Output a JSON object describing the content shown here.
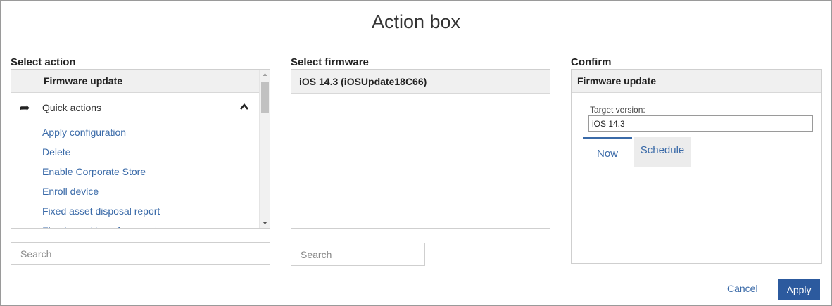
{
  "dialog": {
    "title": "Action box"
  },
  "select_action": {
    "label": "Select action",
    "header": "Firmware update",
    "group": {
      "label": "Quick actions",
      "icon": "share-arrow-icon",
      "toggle_icon": "chevron-up-icon"
    },
    "items": [
      {
        "label": "Apply configuration"
      },
      {
        "label": "Delete"
      },
      {
        "label": "Enable Corporate Store"
      },
      {
        "label": "Enroll device"
      },
      {
        "label": "Fixed asset disposal report"
      },
      {
        "label": "Fixed asset transfer report"
      }
    ],
    "search_placeholder": "Search"
  },
  "select_firmware": {
    "label": "Select firmware",
    "items": [
      {
        "label": "iOS 14.3 (iOSUpdate18C66)"
      }
    ],
    "search_placeholder": "Search"
  },
  "confirm": {
    "label": "Confirm",
    "header": "Firmware update",
    "target_version_label": "Target version:",
    "target_version_value": "iOS 14.3",
    "tabs": [
      {
        "label": "Now",
        "active": true
      },
      {
        "label": "Schedule",
        "active": false
      }
    ]
  },
  "footer": {
    "cancel_label": "Cancel",
    "apply_label": "Apply"
  },
  "colors": {
    "link": "#3a6aa8",
    "primary_button": "#2c5a9e",
    "header_bg": "#f0f0f0",
    "border": "#cfcfcf"
  }
}
